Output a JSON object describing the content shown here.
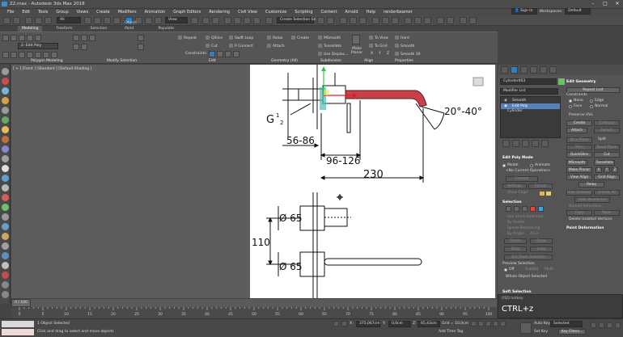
{
  "title": "Z2.max - Autodesk 3ds Max 2018",
  "menu": [
    "File",
    "Edit",
    "Tools",
    "Group",
    "Views",
    "Create",
    "Modifiers",
    "Animation",
    "Graph Editors",
    "Rendering",
    "Civil View",
    "Customize",
    "Scripting",
    "Content",
    "Arnold",
    "Help",
    "renderbeamer"
  ],
  "signin": "Sign In",
  "workspaces_label": "Workspaces:",
  "workspace_value": "Default",
  "toolbar": {
    "filter": "All",
    "view": "View",
    "selection_set": "Create Selection Se"
  },
  "ribbon_tabs": [
    "Modeling",
    "Freeform",
    "Selection",
    "Object Paint",
    "Populate"
  ],
  "ribbon": {
    "edit_poly": "2: Edit Poly",
    "repeat": "Repeat",
    "qslice": "QSlice",
    "swift_loop": "Swift Loop",
    "cut": "Cut",
    "p_connect": "P Connect",
    "constraints": "Constraints:",
    "relax": "Relax",
    "create": "Create",
    "attach": "Attach",
    "msmooth": "MSmooth",
    "tessellate": "Tessellate",
    "use_displac": "Use Displac...",
    "make_planar": "Make Planar",
    "to_view": "To View",
    "to_grid": "To Grid",
    "x_axis": "X",
    "y_axis": "Y",
    "z_axis": "Z",
    "hard": "Hard",
    "smooth": "Smooth",
    "smooth30": "Smooth 30",
    "groups": [
      "Polygon Modeling",
      "Modify Selection",
      "Edit",
      "Geometry (All)",
      "Subdivision",
      "Align",
      "Properties"
    ]
  },
  "viewport_label": "[ + ] [Front ] [Standard ] [Default Shading ]",
  "drawing": {
    "g_label": "G",
    "g_sup": "1",
    "g_sub": "2",
    "angle": "20°-40°",
    "dim_56_86": "56-86",
    "dim_96_126": "96-126",
    "dim_230": "230",
    "dia_top": "Ø 65",
    "dia_bottom": "Ø 65",
    "dim_110": "110"
  },
  "panel": {
    "object_name": "Cylinder003",
    "modifier_list": "Modifier List",
    "stack": [
      "Smooth",
      "Edit Poly",
      "Cylinder"
    ],
    "edit_geometry": "Edit Geometry",
    "repeat_last": "Repeat Last",
    "constraints": "Constraints",
    "c_none": "None",
    "c_edge": "Edge",
    "c_face": "Face",
    "c_normal": "Normal",
    "preserve_uvs": "Preserve UVs",
    "create": "Create",
    "collapse": "Collapse",
    "attach": "Attach",
    "detach": "Detach",
    "slice_plane": "Slice Plane",
    "split": "Split",
    "slice": "Slice",
    "reset_plane": "Reset Plane",
    "quickslice": "QuickSlice",
    "cut": "Cut",
    "msmooth": "MSmooth",
    "tessellate": "Tessellate",
    "make_planar": "Make Planar",
    "x": "X",
    "y": "Y",
    "z": "Z",
    "view_align": "View Align",
    "grid_align": "Grid Align",
    "relax": "Relax",
    "hide_selected": "Hide Selected",
    "unhide_all": "Unhide All",
    "hide_unselected": "Hide Unselected",
    "named_selections": "Named Selections:",
    "copy": "Copy",
    "paste": "Paste",
    "delete_isolated": "Delete Isolated Vertices",
    "paint_deformation": "Paint Deformation",
    "edit_poly_mode": "Edit Poly Mode",
    "model": "Model",
    "animate": "Animate",
    "no_current_op": "<No Current Operation>",
    "commit": "Commit",
    "settings": "Settings",
    "cancel": "Cancel",
    "show_cage": "Show Cage",
    "selection": "Selection",
    "use_stack_sel": "Use Stack Selection",
    "by_vertex": "By Vertex",
    "ignore_backfacing": "Ignore Backfacing",
    "by_angle": "By Angle:",
    "by_angle_val": "45.0",
    "shrink": "Shrink",
    "grow": "Grow",
    "ring": "Ring",
    "loop": "Loop",
    "get_stack_sel": "Get Stack Selection",
    "preview_selection": "Preview Selection",
    "off": "Off",
    "subobj": "SubObj",
    "multi": "Multi",
    "whole_object": "Whole Object Selected",
    "soft_selection": "Soft Selection"
  },
  "timeline": {
    "frame": "0 / 100",
    "ticks": [
      "0",
      "5",
      "10",
      "15",
      "20",
      "25",
      "30",
      "35",
      "40",
      "45",
      "50",
      "55",
      "60",
      "65",
      "70",
      "75",
      "80",
      "85",
      "90",
      "95",
      "100"
    ]
  },
  "status": {
    "selected": "1 Object Selected",
    "hint": "Click and drag to select and move objects",
    "x": "375,067cm",
    "y": "0,0cm",
    "z": "65,43cm",
    "grid": "Grid = 10,0cm",
    "add_time_tag": "Add Time Tag",
    "auto_key": "Auto Key",
    "selected_dd": "Selected",
    "set_key": "Set Key",
    "key_filters": "Key Filters..."
  },
  "osd": {
    "title": "OSD hotkey",
    "key": "CTRL+z"
  }
}
